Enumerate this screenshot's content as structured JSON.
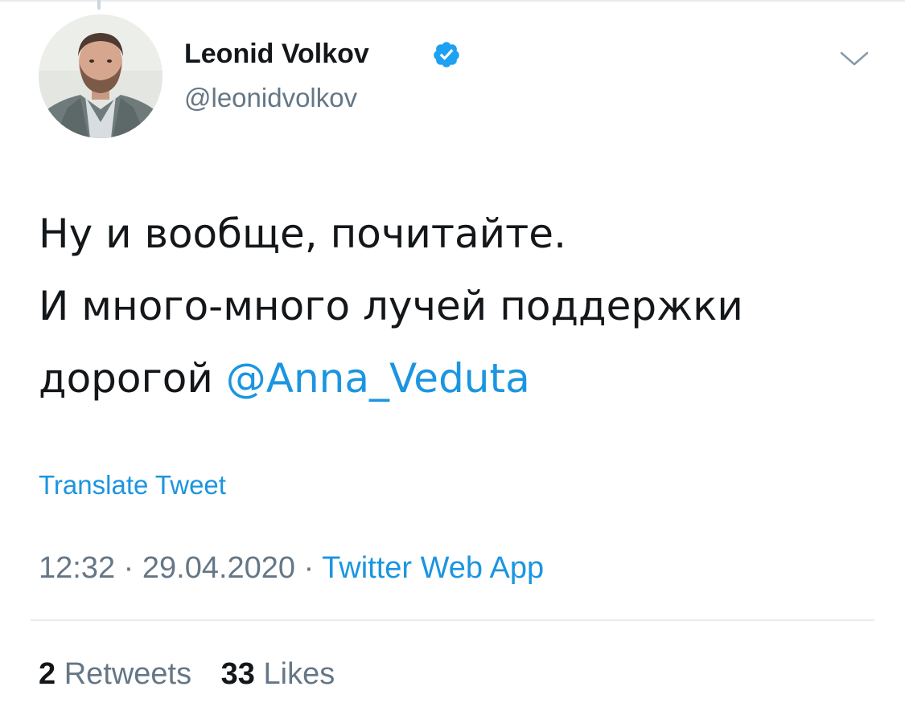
{
  "tweet": {
    "author": {
      "name": "Leonid Volkov",
      "handle": "@leonidvolkov",
      "verified": true,
      "avatar": "profile-photo"
    },
    "text_lines": [
      "Ну и вообще, почитайте.",
      "И много-много лучей поддержки",
      "дорогой"
    ],
    "mention": "@Anna_Veduta",
    "translate_label": "Translate Tweet",
    "time": "12:32",
    "date": "29.04.2020",
    "separator": "·",
    "source": "Twitter Web App",
    "retweets": {
      "count": "2",
      "label": "Retweets"
    },
    "likes": {
      "count": "33",
      "label": "Likes"
    }
  },
  "icons": {
    "verified": "verified-badge-icon",
    "menu": "chevron-down-icon"
  },
  "colors": {
    "text": "#14171a",
    "secondary": "#657786",
    "accent": "#1b95e0",
    "divider": "#e6ecf0"
  }
}
